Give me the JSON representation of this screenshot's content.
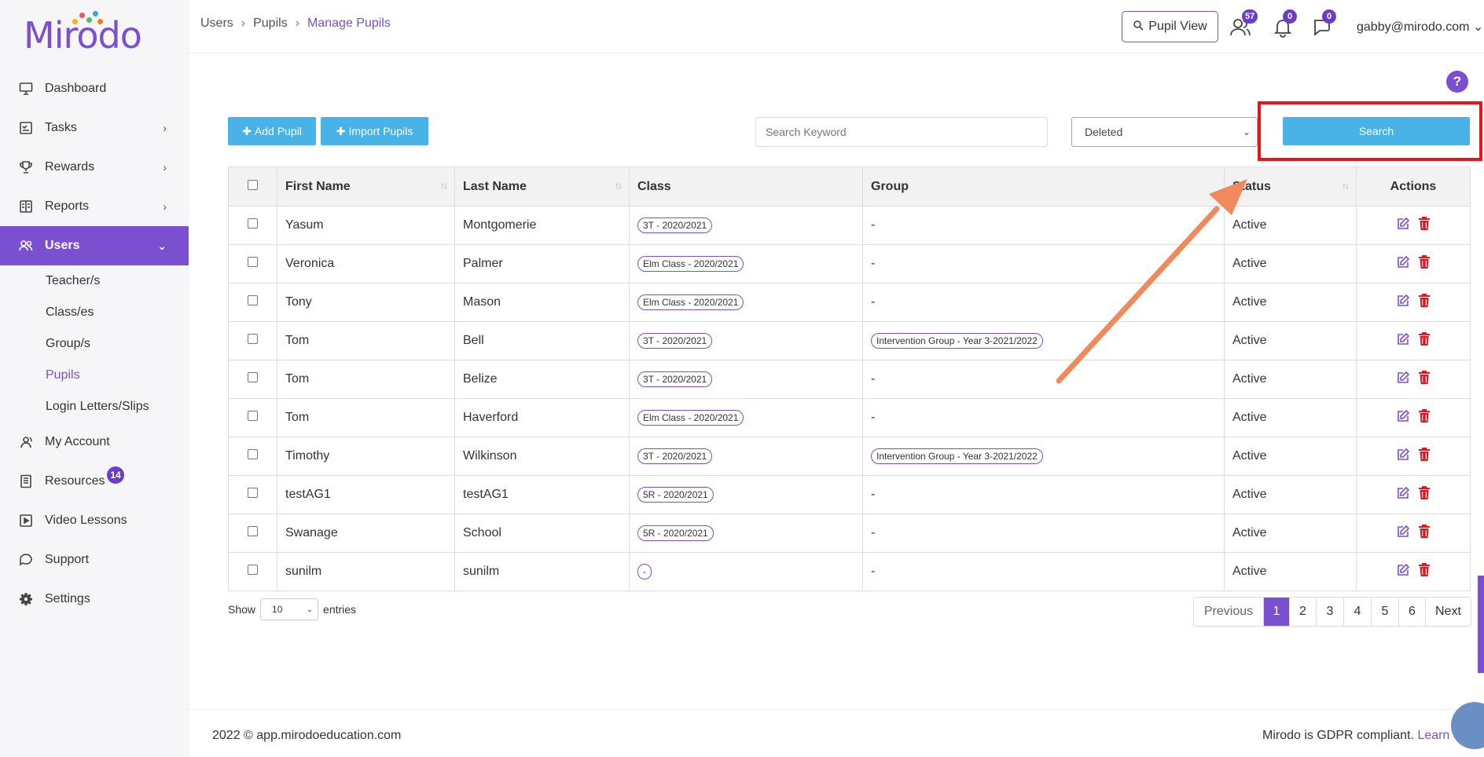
{
  "brand": {
    "logo_text": "Mirodo"
  },
  "sidebar": {
    "items": [
      {
        "label": "Dashboard",
        "icon": "monitor-icon",
        "has_arrow": false
      },
      {
        "label": "Tasks",
        "icon": "checklist-icon",
        "has_arrow": true
      },
      {
        "label": "Rewards",
        "icon": "trophy-icon",
        "has_arrow": true
      },
      {
        "label": "Reports",
        "icon": "report-icon",
        "has_arrow": true
      },
      {
        "label": "Users",
        "icon": "users-icon",
        "has_arrow": true,
        "active": true
      }
    ],
    "sub_items": [
      "Teacher/s",
      "Class/es",
      "Group/s",
      "Pupils",
      "Login Letters/Slips"
    ],
    "current_sub": "Pupils",
    "items_after": [
      {
        "label": "My Account",
        "icon": "account-icon"
      },
      {
        "label": "Resources",
        "icon": "book-icon",
        "badge": "14"
      },
      {
        "label": "Video Lessons",
        "icon": "video-icon"
      },
      {
        "label": "Support",
        "icon": "chat-icon"
      },
      {
        "label": "Settings",
        "icon": "gear-icon"
      }
    ]
  },
  "breadcrumb": [
    "Users",
    "Pupils",
    "Manage Pupils"
  ],
  "topbar": {
    "pupil_view_label": "Pupil View",
    "users_count": "57",
    "notifications_count": "0",
    "messages_count": "0",
    "user_email": "gabby@mirodo.com"
  },
  "help_label": "?",
  "toolbar": {
    "add_pupil": "Add Pupil",
    "import_pupils": "Import Pupils",
    "search_placeholder": "Search Keyword",
    "status_value": "Deleted",
    "search_button": "Search"
  },
  "table": {
    "columns": [
      "First Name",
      "Last Name",
      "Class",
      "Group",
      "Status",
      "Actions"
    ],
    "rows": [
      {
        "first": "Yasum",
        "last": "Montgomerie",
        "class": "3T - 2020/2021",
        "group": "-",
        "status": "Active"
      },
      {
        "first": "Veronica",
        "last": "Palmer",
        "class": "Elm Class - 2020/2021",
        "group": "-",
        "status": "Active"
      },
      {
        "first": "Tony",
        "last": "Mason",
        "class": "Elm Class - 2020/2021",
        "group": "-",
        "status": "Active"
      },
      {
        "first": "Tom",
        "last": "Bell",
        "class": "3T - 2020/2021",
        "group": "Intervention Group - Year 3-2021/2022",
        "status": "Active"
      },
      {
        "first": "Tom",
        "last": "Belize",
        "class": "3T - 2020/2021",
        "group": "-",
        "status": "Active"
      },
      {
        "first": "Tom",
        "last": "Haverford",
        "class": "Elm Class - 2020/2021",
        "group": "-",
        "status": "Active"
      },
      {
        "first": "Timothy",
        "last": "Wilkinson",
        "class": "3T - 2020/2021",
        "group": "Intervention Group - Year 3-2021/2022",
        "status": "Active"
      },
      {
        "first": "testAG1",
        "last": "testAG1",
        "class": "5R - 2020/2021",
        "group": "-",
        "status": "Active"
      },
      {
        "first": "Swanage",
        "last": "School",
        "class": "5R - 2020/2021",
        "group": "-",
        "status": "Active"
      },
      {
        "first": "sunilm",
        "last": "sunilm",
        "class": "-",
        "group": "-",
        "status": "Active"
      }
    ]
  },
  "pagination": {
    "show_label": "Show",
    "entries_value": "10",
    "entries_label": "entries",
    "previous": "Previous",
    "pages": [
      "1",
      "2",
      "3",
      "4",
      "5",
      "6"
    ],
    "current": "1",
    "next": "Next"
  },
  "footer": {
    "copyright": "2022 © app.mirodoeducation.com",
    "gdpr_text": "Mirodo is GDPR compliant.",
    "gdpr_link": "Learn"
  },
  "colors": {
    "accent": "#7a4fd0",
    "button_blue": "#49b3e8",
    "delete_red": "#e8141b",
    "annotation_arrow": "#f08a5d"
  }
}
